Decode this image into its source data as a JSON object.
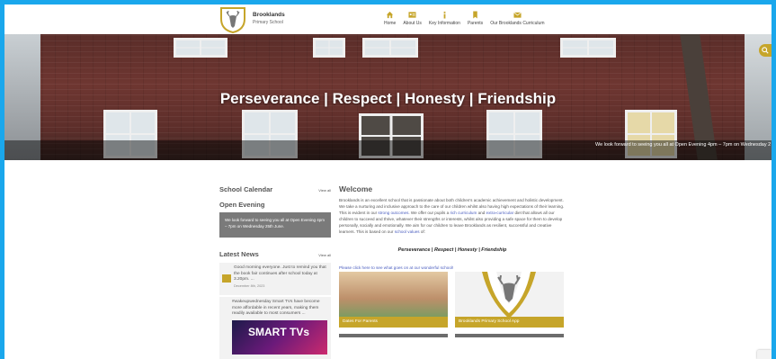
{
  "header": {
    "brand_name": "Brooklands",
    "brand_sub": "Primary School",
    "nav": [
      {
        "label": "Home",
        "icon": "home-icon"
      },
      {
        "label": "About Us",
        "icon": "id-card-icon"
      },
      {
        "label": "Key Information",
        "icon": "info-icon"
      },
      {
        "label": "Parents",
        "icon": "bookmark-icon"
      },
      {
        "label": "Our Brooklands Curriculum",
        "icon": "mail-icon"
      }
    ]
  },
  "hero": {
    "title": "Perseverance | Respect | Honesty | Friendship",
    "ticker": "We look forward to seeing you all at Open Evening 4pm – 7pm on Wednesday 2"
  },
  "sidebar": {
    "calendar_title": "School Calendar",
    "calendar_view_all": "View all",
    "event_title": "Open Evening",
    "event_text": "We look forward to seeing you all at Open Evening 4pm – 7pm on Wednesday 25th June.",
    "news_title": "Latest News",
    "news_view_all": "View all",
    "news_items": [
      {
        "text": "Good morning everyone. Just to remind you that the book fair continues after school today at 3.20pm. ...",
        "date": "December 8th, 2023"
      },
      {
        "text": "#wakeupwednesday Smart TVs have become more affordable in recent years, making them readily available to most consumers ...",
        "thumb_text": "SMART TVs"
      }
    ]
  },
  "main": {
    "title": "Welcome",
    "intro_1": "Brooklands is an excellent school that is passionate about both children's academic achievement and holistic development. We take a nurturing and inclusive approach to the care of our children whilst also having high expectations of their learning. This is evident in our ",
    "link_outcomes": "strong outcomes",
    "intro_2": ". We offer our pupils a ",
    "link_curriculum": "rich curriculum",
    "intro_3": " and ",
    "link_extra": "extra-curricular",
    "intro_4": " diet that allows all our children to succeed and thrive, whatever their strengths or interests, whilst also providing a safe space for them to develop personally, socially and emotionally. We aim for our children to leave Brooklands as resilient, successful and creative learners. This is based on our ",
    "link_values": "school values",
    "intro_5": " of:",
    "motto": "Perseverance | Respect | Honesty | Friendship",
    "click_link": "Please click here to see what goes on at our wonderful school!",
    "tiles": [
      {
        "caption": "Dates For Parents"
      },
      {
        "caption": "Brooklands Primary School App"
      }
    ]
  },
  "colors": {
    "accent": "#c6a52a",
    "frame_border": "#1aa7ec",
    "link": "#4a5dbf"
  }
}
